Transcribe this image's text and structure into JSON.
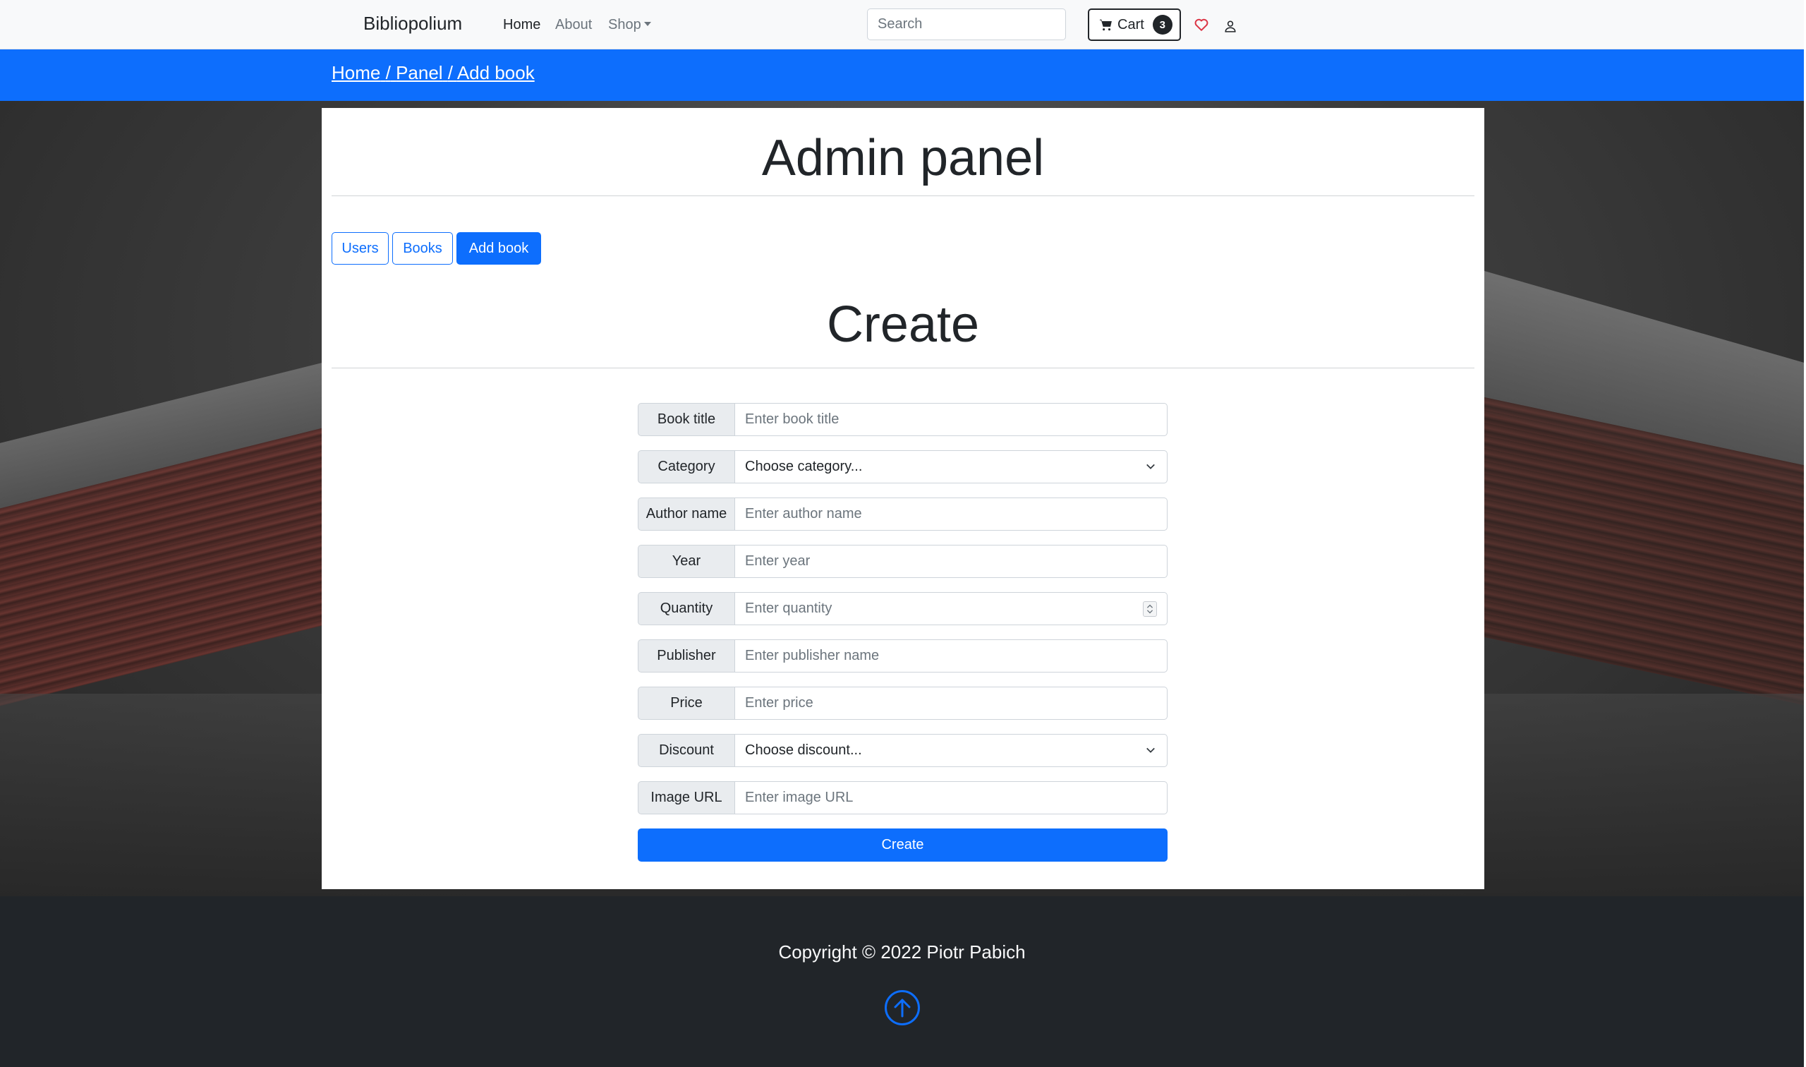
{
  "navbar": {
    "brand": "Bibliopolium",
    "links": [
      {
        "label": "Home",
        "active": true
      },
      {
        "label": "About",
        "active": false
      },
      {
        "label": "Shop",
        "active": false
      }
    ],
    "search_placeholder": "Search",
    "cart_label": "Cart",
    "cart_count": "3",
    "icons": [
      "cart-icon",
      "heart-icon",
      "user-icon"
    ]
  },
  "breadcrumb": {
    "items": [
      "Home",
      "Panel",
      "Add book"
    ],
    "separator": "/"
  },
  "panel": {
    "title": "Admin panel",
    "tabs": [
      {
        "label": "Users",
        "active": false
      },
      {
        "label": "Books",
        "active": false
      },
      {
        "label": "Add book",
        "active": true
      }
    ],
    "section_title": "Create"
  },
  "form": {
    "fields": [
      {
        "label": "Book title",
        "placeholder": "Enter book title",
        "type": "text"
      },
      {
        "label": "Category",
        "placeholder": "Choose category...",
        "type": "select"
      },
      {
        "label": "Author name",
        "placeholder": "Enter author name",
        "type": "text"
      },
      {
        "label": "Year",
        "placeholder": "Enter year",
        "type": "text"
      },
      {
        "label": "Quantity",
        "placeholder": "Enter quantity",
        "type": "number"
      },
      {
        "label": "Publisher",
        "placeholder": "Enter publisher name",
        "type": "text"
      },
      {
        "label": "Price",
        "placeholder": "Enter price",
        "type": "text"
      },
      {
        "label": "Discount",
        "placeholder": "Choose discount...",
        "type": "select"
      },
      {
        "label": "Image URL",
        "placeholder": "Enter image URL",
        "type": "text"
      }
    ],
    "submit_label": "Create"
  },
  "footer": {
    "copyright": "Copyright © 2022 Piotr Pabich",
    "icon": "arrow-up-circle-icon"
  },
  "colors": {
    "primary": "#0d6efd",
    "navbar_bg": "#f8f9fa",
    "footer_bg": "#212529",
    "heart": "#dc3545"
  }
}
